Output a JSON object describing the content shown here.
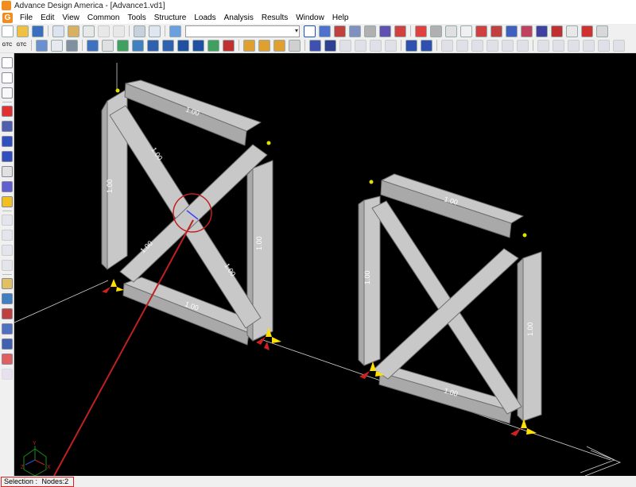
{
  "window": {
    "title": "Advance Design America - [Advance1.vd1]"
  },
  "menu": {
    "items": [
      "File",
      "Edit",
      "View",
      "Common",
      "Tools",
      "Structure",
      "Loads",
      "Analysis",
      "Results",
      "Window",
      "Help"
    ]
  },
  "toolbar": {
    "combo_value": "",
    "gtc1": "GTC",
    "gtc2": "GTC"
  },
  "accent_colors": {
    "app_icon": "#f28c1e",
    "viewport_bg": "#000000",
    "member_fill": "#c8c8c8",
    "support": "#ffe000",
    "highlight": "#c02020"
  },
  "model": {
    "member_labels": [
      "1.00",
      "1.00",
      "1.00",
      "1.00",
      "1.00",
      "1.00",
      "1.00",
      "1.00",
      "1.00",
      "1.00"
    ]
  },
  "axis": {
    "x": "X",
    "y": "Y",
    "z": "Z"
  },
  "status": {
    "selection_label": "Selection :",
    "nodes_value": "Nodes:2"
  }
}
